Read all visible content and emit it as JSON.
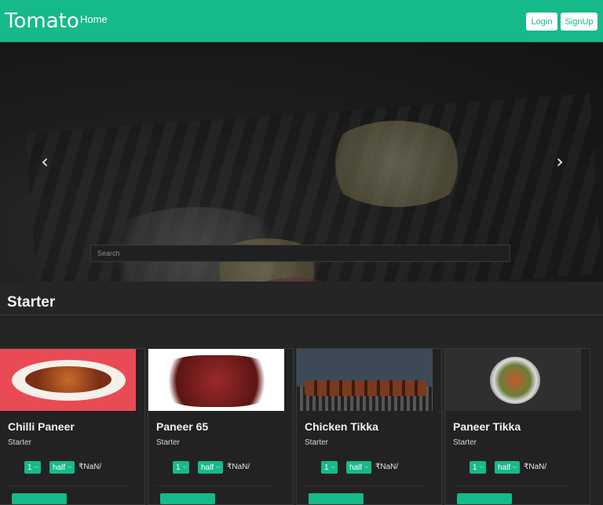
{
  "navbar": {
    "brand": "Tomato",
    "home_label": "Home",
    "login_label": "Login",
    "signup_label": "SignUp",
    "accent_color": "#16b98a"
  },
  "carousel": {
    "prev_icon": "chevron-left-icon",
    "next_icon": "chevron-right-icon",
    "prev_glyph": "‹",
    "next_glyph": "›"
  },
  "search": {
    "placeholder": "Search"
  },
  "section": {
    "title": "Starter"
  },
  "cards": [
    {
      "name": "Chilli Paneer",
      "category": "Starter",
      "qty": "1",
      "size": "half",
      "price": "₹NaN/"
    },
    {
      "name": "Paneer 65",
      "category": "Starter",
      "qty": "1",
      "size": "half",
      "price": "₹NaN/"
    },
    {
      "name": "Chicken Tikka",
      "category": "Starter",
      "qty": "1",
      "size": "half",
      "price": "₹NaN/"
    },
    {
      "name": "Paneer Tikka",
      "category": "Starter",
      "qty": "1",
      "size": "half",
      "price": "₹NaN/"
    }
  ]
}
